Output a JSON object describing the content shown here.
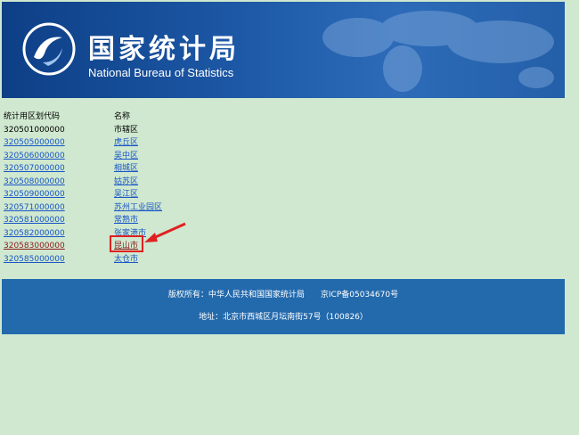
{
  "banner": {
    "title_cn": "国家统计局",
    "title_en": "National Bureau of Statistics"
  },
  "table": {
    "headers": [
      "统计用区划代码",
      "名称"
    ],
    "rows": [
      {
        "code": "320501000000",
        "name": "市辖区",
        "linked": false
      },
      {
        "code": "320505000000",
        "name": "虎丘区",
        "linked": true
      },
      {
        "code": "320506000000",
        "name": "吴中区",
        "linked": true
      },
      {
        "code": "320507000000",
        "name": "相城区",
        "linked": true
      },
      {
        "code": "320508000000",
        "name": "姑苏区",
        "linked": true
      },
      {
        "code": "320509000000",
        "name": "吴江区",
        "linked": true
      },
      {
        "code": "320571000000",
        "name": "苏州工业园区",
        "linked": true
      },
      {
        "code": "320581000000",
        "name": "常熟市",
        "linked": true
      },
      {
        "code": "320582000000",
        "name": "张家港市",
        "linked": true
      },
      {
        "code": "320583000000",
        "name": "昆山市",
        "linked": true
      },
      {
        "code": "320585000000",
        "name": "太仓市",
        "linked": true
      }
    ]
  },
  "footer": {
    "copyright": "版权所有：中华人民共和国国家统计局",
    "icp": "京ICP备05034670号",
    "address": "地址：北京市西城区月坛南街57号（100826）"
  },
  "colors": {
    "page_bg": "#cfe8cf",
    "banner_blue": "#1e5aa8",
    "footer_blue": "#236aad",
    "link": "#1a56c7",
    "visited_link": "#8b1a1a",
    "highlight": "#e02020"
  }
}
